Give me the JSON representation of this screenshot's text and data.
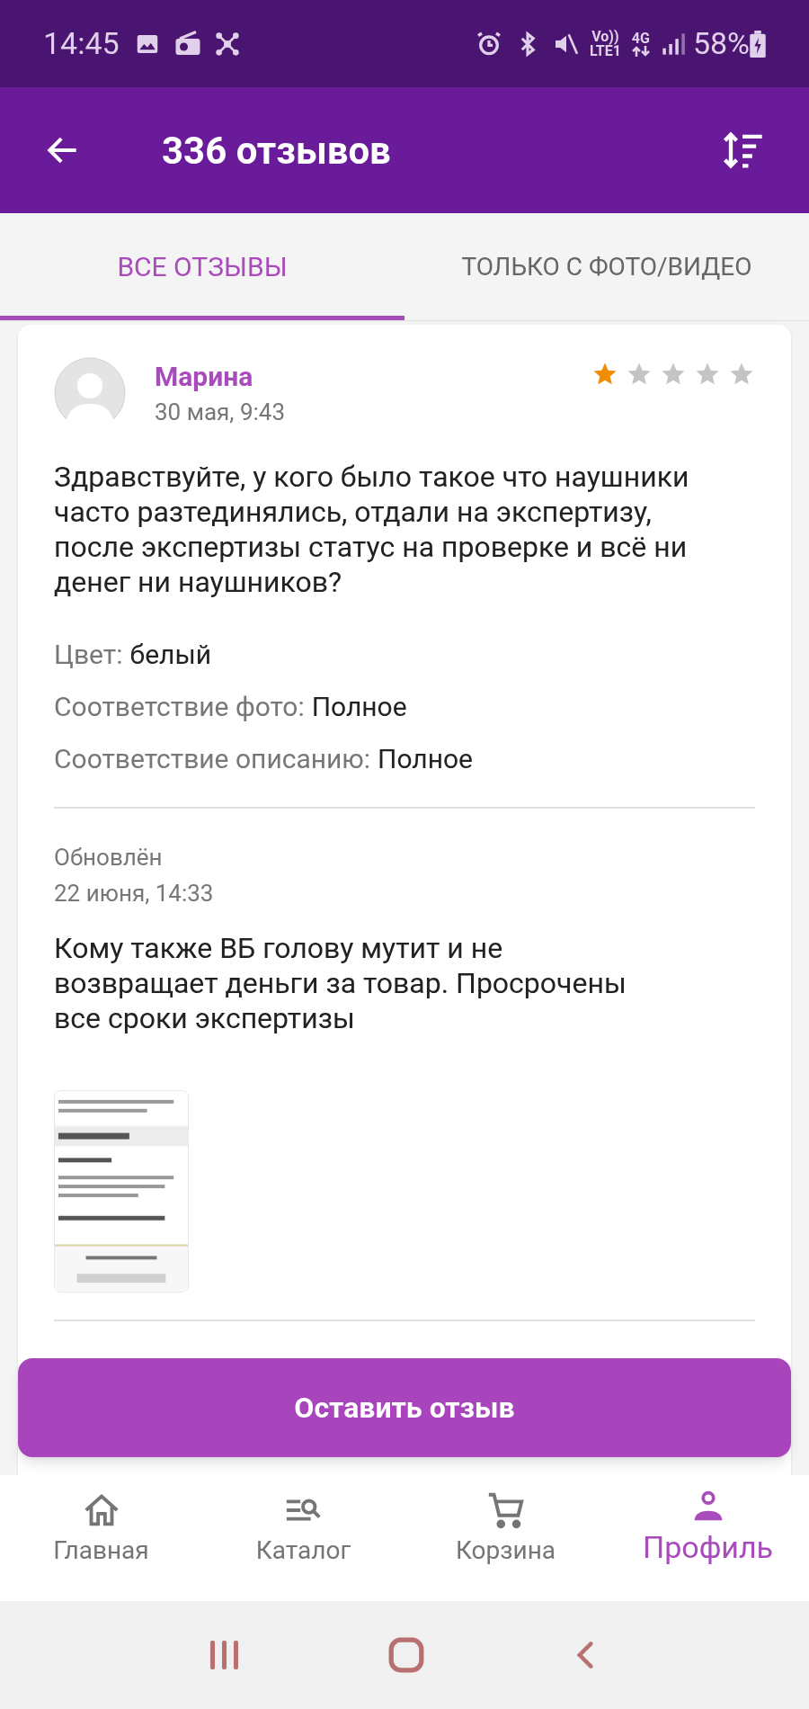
{
  "status_bar": {
    "time": "14:45",
    "volte": "Vo))",
    "lte": "LTE1",
    "network": "4G",
    "battery": "58%"
  },
  "app_bar": {
    "title": "336 отзывов"
  },
  "tabs": [
    {
      "label": "ВСЕ ОТЗЫВЫ",
      "selected": true
    },
    {
      "label": "ТОЛЬКО С ФОТО/ВИДЕО",
      "selected": false
    }
  ],
  "review": {
    "author": "Марина",
    "date": "30 мая, 9:43",
    "stars": 1,
    "text": "Здравствуйте, у кого было такое что наушники часто разтединялись, отдали на экспертизу, после экспертизы статус на проверке и всё ни  денег ни наушников?",
    "attributes": [
      {
        "label": "Цвет:",
        "value": "белый"
      },
      {
        "label": "Соответствие фото:",
        "value": "Полное"
      },
      {
        "label": "Соответствие описанию:",
        "value": "Полное"
      }
    ],
    "update": {
      "label": "Обновлён",
      "date": "22 июня, 14:33",
      "text": "Кому также ВБ голову мутит и не возвращает деньги за товар. Просрочены все сроки экспертизы"
    }
  },
  "action_button": {
    "label": "Оставить отзыв"
  },
  "bottom_nav": [
    {
      "label": "Главная",
      "kind": "home",
      "selected": false
    },
    {
      "label": "Каталог",
      "kind": "catalog",
      "selected": false
    },
    {
      "label": "Корзина",
      "kind": "cart",
      "selected": false
    },
    {
      "label": "Профиль",
      "kind": "profile",
      "selected": true
    }
  ]
}
